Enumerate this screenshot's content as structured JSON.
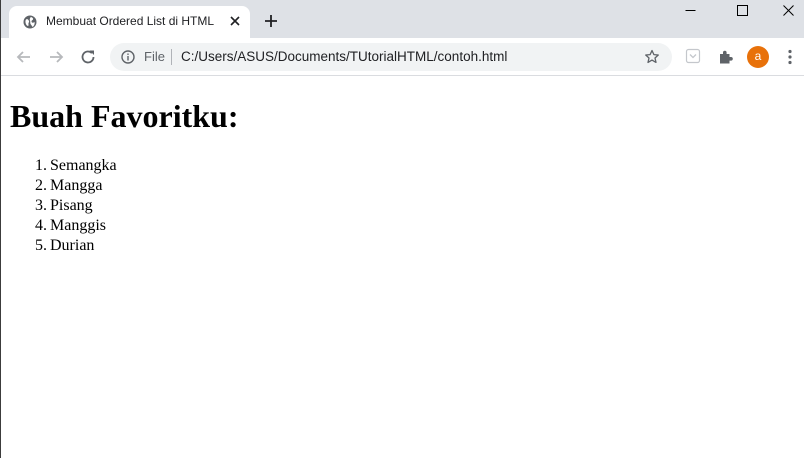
{
  "browser": {
    "tab": {
      "title": "Membuat Ordered List di HTML"
    },
    "omnibox": {
      "scheme_label": "File",
      "url": "C:/Users/ASUS/Documents/TUtorialHTML/contoh.html"
    },
    "profile_initial": "a",
    "accent_color": "#e8710a"
  },
  "page": {
    "heading": "Buah Favoritku:",
    "list": [
      {
        "number": "1.",
        "text": "Semangka"
      },
      {
        "number": "2.",
        "text": "Mangga"
      },
      {
        "number": "3.",
        "text": "Pisang"
      },
      {
        "number": "4.",
        "text": "Manggis"
      },
      {
        "number": "5.",
        "text": "Durian"
      }
    ]
  }
}
